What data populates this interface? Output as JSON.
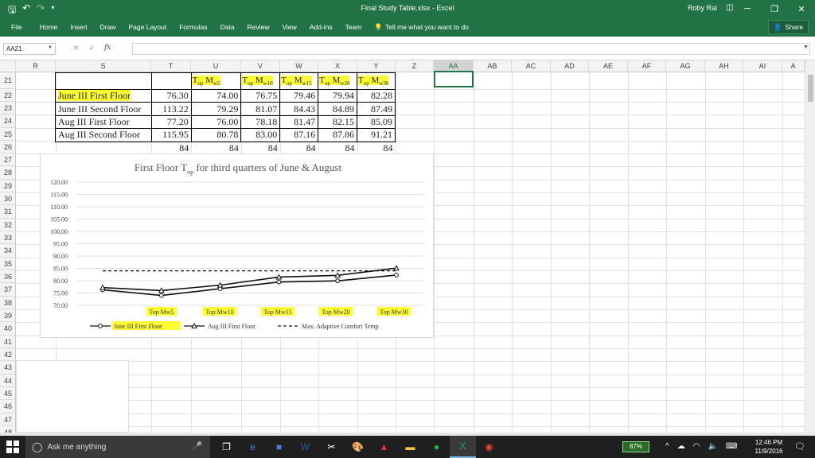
{
  "window": {
    "title": "Final Study Table.xlsx - Excel",
    "user": "Roby Rai",
    "controls": [
      "─",
      "❐",
      "✕"
    ]
  },
  "ribbon": {
    "tabs": [
      "File",
      "Home",
      "Insert",
      "Draw",
      "Page Layout",
      "Formulas",
      "Data",
      "Review",
      "View",
      "Add-ins",
      "Team"
    ],
    "tell_me": "Tell me what you want to do",
    "share": "Share"
  },
  "formula_bar": {
    "name_box": "AA21",
    "formula": ""
  },
  "grid": {
    "columns": [
      "R",
      "S",
      "T",
      "U",
      "V",
      "W",
      "X",
      "Y",
      "Z",
      "AA",
      "AB",
      "AC",
      "AD",
      "AE",
      "AF",
      "AG",
      "AH",
      "AI",
      "A"
    ],
    "selected_column": "AA",
    "rows": [
      "21",
      "22",
      "23",
      "24",
      "25",
      "26",
      "27",
      "28",
      "29",
      "30",
      "31",
      "32",
      "33",
      "34",
      "35",
      "36",
      "37",
      "38",
      "39",
      "40",
      "41",
      "42",
      "43",
      "44",
      "45",
      "46",
      "47",
      "48"
    ]
  },
  "table": {
    "headers": [
      {
        "main": "T",
        "sub1": "op",
        "mid": " M",
        "sub2": "w5"
      },
      {
        "main": "T",
        "sub1": "op",
        "mid": " M",
        "sub2": "w10"
      },
      {
        "main": "T",
        "sub1": "op",
        "mid": " M",
        "sub2": "w15"
      },
      {
        "main": "T",
        "sub1": "op",
        "mid": " M",
        "sub2": "w20"
      },
      {
        "main": "T",
        "sub1": "op",
        "mid": " M",
        "sub2": "w30"
      }
    ],
    "rows": [
      {
        "label": "June III First Floor",
        "highlight": "June III First Floo",
        "rest": "r",
        "t": "76.30",
        "values": [
          "74.00",
          "76.75",
          "79.46",
          "79.94",
          "82.28"
        ]
      },
      {
        "label": "June III Second Floor",
        "t": "113.22",
        "values": [
          "79.29",
          "81.07",
          "84.43",
          "84.89",
          "87.49"
        ]
      },
      {
        "label": "Aug III First Floor",
        "t": "77.20",
        "values": [
          "76.00",
          "78.18",
          "81.47",
          "82.15",
          "85.09"
        ]
      },
      {
        "label": "Aug III Second Floor",
        "t": "115.95",
        "values": [
          "80.78",
          "83.00",
          "87.16",
          "87.86",
          "91.21"
        ]
      }
    ],
    "footer": [
      "84",
      "84",
      "84",
      "84",
      "84",
      "84"
    ]
  },
  "chart_data": {
    "type": "line",
    "title_main": "First Floor T",
    "title_sub": "op",
    "title_rest": " for third quarters of June & August",
    "categories": [
      "Top Mw5",
      "Top Mw10",
      "Top Mw15",
      "Top Mw20",
      "Top Mw30"
    ],
    "y_ticks": [
      "120.00",
      "115.00",
      "110.00",
      "105.00",
      "100.00",
      "95.00",
      "90.00",
      "85.00",
      "80.00",
      "75.00",
      "70.00"
    ],
    "ylim": [
      70,
      120
    ],
    "x": [
      0,
      1,
      2,
      3,
      4,
      5
    ],
    "series": [
      {
        "name": "June III First Floor",
        "values": [
          76.3,
          74.0,
          76.75,
          79.46,
          79.94,
          82.28
        ],
        "marker": "circle",
        "dash": false
      },
      {
        "name": "Aug III First Floor",
        "values": [
          77.2,
          76.0,
          78.18,
          81.47,
          82.15,
          85.09
        ],
        "marker": "triangle",
        "dash": false
      },
      {
        "name": "Max. Adaptive Comfort Temp",
        "values": [
          84,
          84,
          84,
          84,
          84,
          84
        ],
        "marker": "none",
        "dash": true
      }
    ],
    "grid": true,
    "legend": "bottom",
    "highlight_color": "#ffff33"
  },
  "taskbar": {
    "search_placeholder": "Ask me anything",
    "battery": "87%",
    "time": "12:46 PM",
    "date": "11/9/2016"
  }
}
